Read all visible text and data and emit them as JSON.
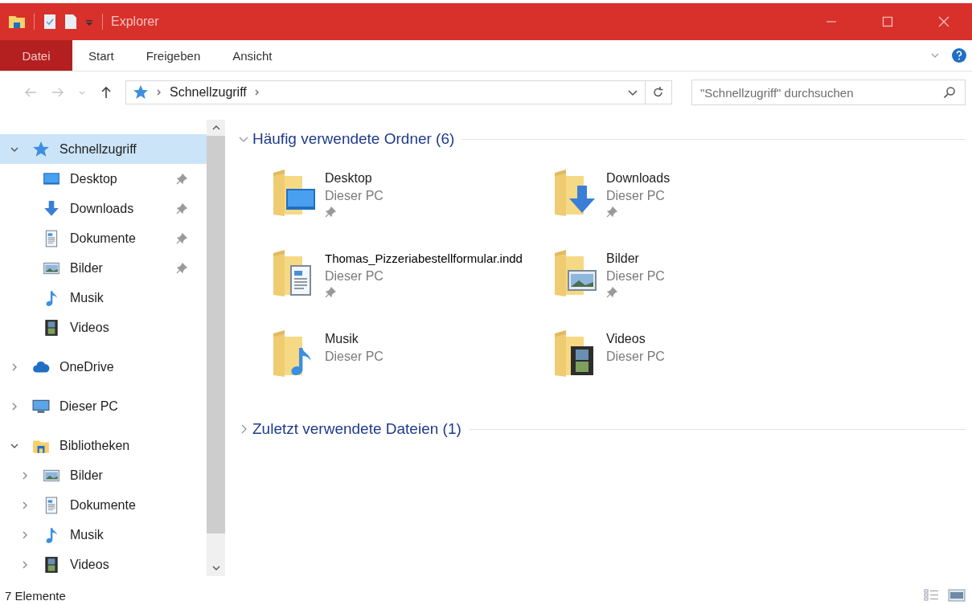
{
  "window": {
    "title": "Explorer"
  },
  "ribbon": {
    "tabs": [
      {
        "label": "Datei",
        "selected": true
      },
      {
        "label": "Start",
        "selected": false
      },
      {
        "label": "Freigeben",
        "selected": false
      },
      {
        "label": "Ansicht",
        "selected": false
      }
    ]
  },
  "address_bar": {
    "path": [
      "Schnellzugriff"
    ]
  },
  "search": {
    "placeholder": "\"Schnellzugriff\" durchsuchen"
  },
  "navigation": {
    "items": [
      {
        "label": "Schnellzugriff",
        "kind": "star",
        "expanded": true,
        "selected": true,
        "children": [
          {
            "label": "Desktop",
            "kind": "desktop",
            "pinned": true,
            "selected": false
          },
          {
            "label": "Downloads",
            "kind": "download",
            "pinned": true,
            "selected": false
          },
          {
            "label": "Dokumente",
            "kind": "document",
            "pinned": true,
            "selected": false
          },
          {
            "label": "Bilder",
            "kind": "pictures",
            "pinned": true,
            "selected": false
          },
          {
            "label": "Musik",
            "kind": "music",
            "pinned": false,
            "selected": false
          },
          {
            "label": "Videos",
            "kind": "video",
            "pinned": false,
            "selected": false
          }
        ]
      },
      {
        "label": "OneDrive",
        "kind": "cloud",
        "expanded": false,
        "selected": false
      },
      {
        "label": "Dieser PC",
        "kind": "pc",
        "expanded": false,
        "selected": false
      },
      {
        "label": "Bibliotheken",
        "kind": "library",
        "expanded": true,
        "selected": false,
        "children": [
          {
            "label": "Bilder",
            "kind": "pictures",
            "expanded": false,
            "selected": false
          },
          {
            "label": "Dokumente",
            "kind": "document",
            "expanded": false,
            "selected": false
          },
          {
            "label": "Musik",
            "kind": "music",
            "expanded": false,
            "selected": false
          },
          {
            "label": "Videos",
            "kind": "video",
            "expanded": false,
            "selected": false
          }
        ]
      }
    ]
  },
  "sections": [
    {
      "title": "Häufig verwendete Ordner (6)",
      "expanded": true,
      "items": [
        {
          "name": "Desktop",
          "location": "Dieser PC",
          "kind": "desktop",
          "pinned": true
        },
        {
          "name": "Downloads",
          "location": "Dieser PC",
          "kind": "download",
          "pinned": true
        },
        {
          "name": "Thomas_Pizzeriabestellformular.indd",
          "location": "Dieser PC",
          "kind": "document",
          "pinned": true
        },
        {
          "name": "Bilder",
          "location": "Dieser PC",
          "kind": "pictures",
          "pinned": true
        },
        {
          "name": "Musik",
          "location": "Dieser PC",
          "kind": "music",
          "pinned": false
        },
        {
          "name": "Videos",
          "location": "Dieser PC",
          "kind": "video",
          "pinned": false
        }
      ]
    },
    {
      "title": "Zuletzt verwendete Dateien (1)",
      "expanded": false
    }
  ],
  "status_bar": {
    "text": "7 Elemente"
  }
}
